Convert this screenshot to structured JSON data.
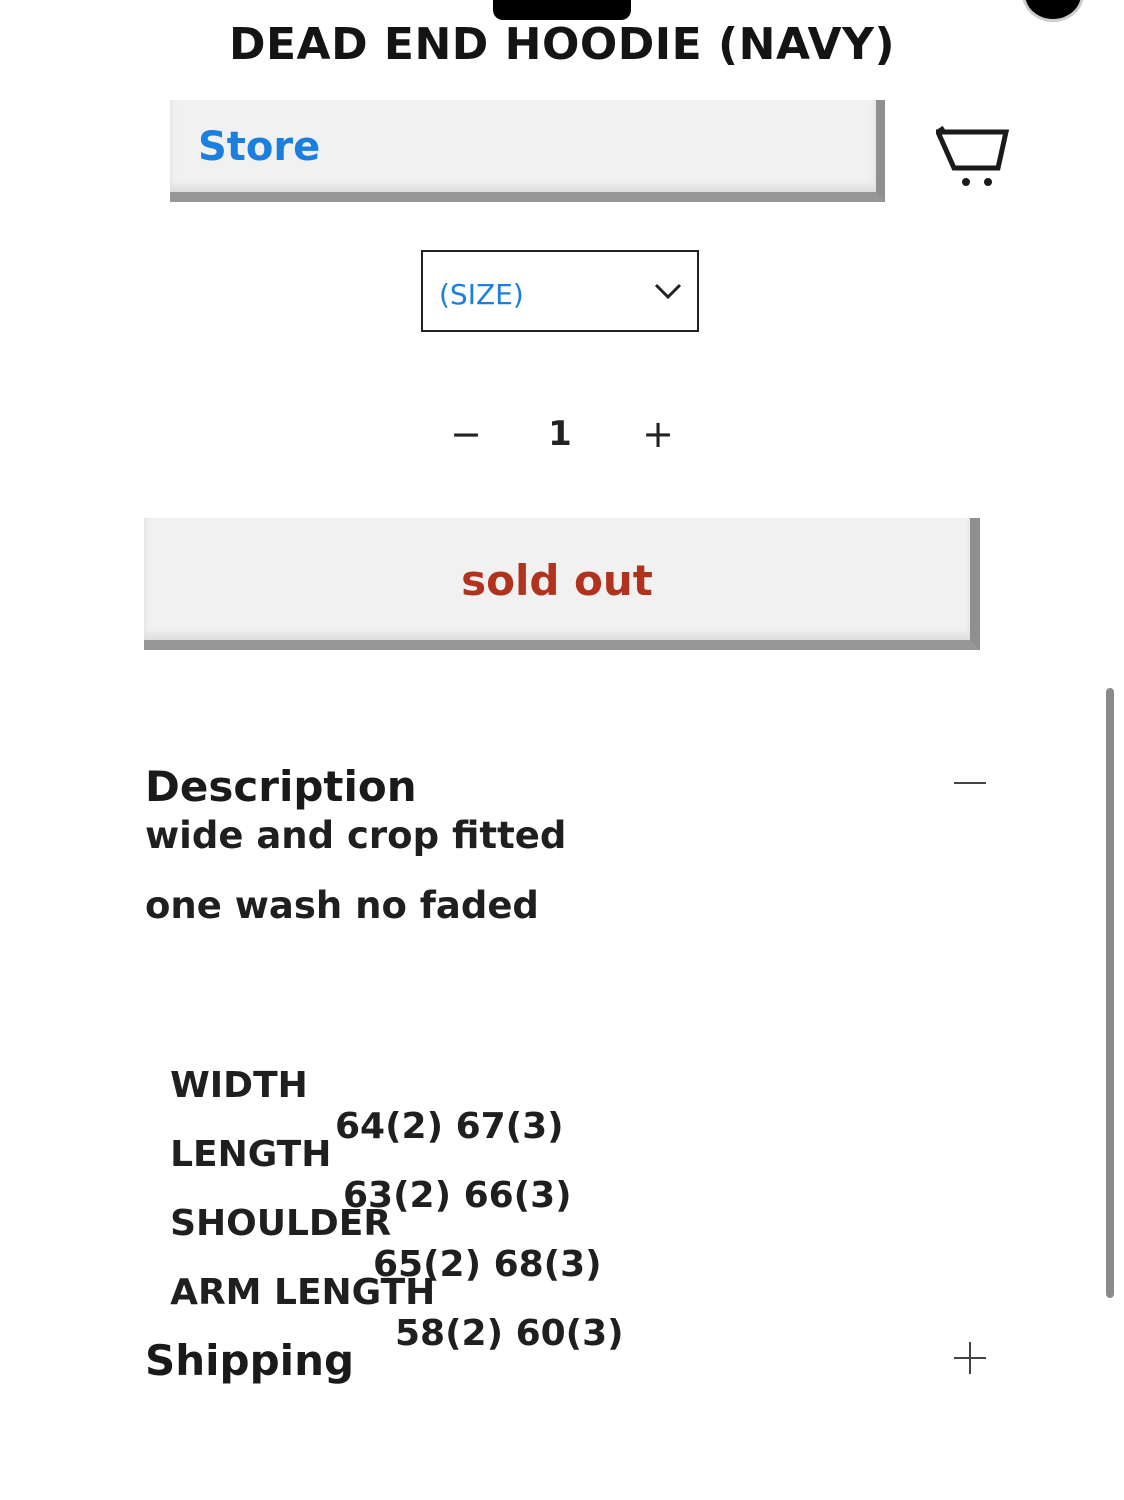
{
  "product": {
    "title": "DEAD END HOODIE (NAVY)"
  },
  "nav": {
    "store_label": "Store",
    "cart_icon": "cart-icon"
  },
  "options": {
    "size_selected": "(SIZE)"
  },
  "quantity": {
    "minus_label": "−",
    "value": "1",
    "plus_label": "+"
  },
  "purchase": {
    "button_label": "sold out"
  },
  "description": {
    "heading": "Description",
    "toggle_label": "—",
    "lines": [
      "wide and crop fitted",
      "one wash no faded"
    ],
    "specs": [
      {
        "label": "WIDTH",
        "value": "64(2) 67(3)"
      },
      {
        "label": "LENGTH",
        "value": "63(2) 66(3)"
      },
      {
        "label": "SHOULDER",
        "value": "65(2) 68(3)"
      },
      {
        "label": "ARM LENGTH",
        "value": "58(2) 60(3)"
      }
    ]
  },
  "shipping": {
    "heading": "Shipping",
    "toggle_label": "+"
  },
  "colors": {
    "link_blue": "#1b7fe0",
    "soldout_red": "#b2331d",
    "bar_gray": "#f1f1f1"
  }
}
